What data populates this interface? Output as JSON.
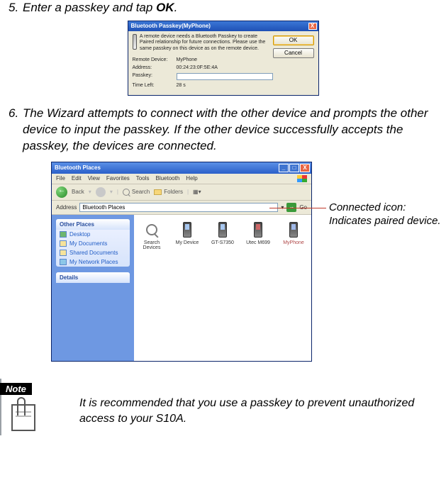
{
  "step5": {
    "num": "5.",
    "text_a": "Enter a passkey and tap ",
    "text_b": "OK",
    "text_c": "."
  },
  "passkey_dialog": {
    "title": "Bluetooth Passkey(MyPhone)",
    "message": "A remote device needs a Bluetooth Passkey to create Paired relationship for future connections. Please use the same passkey on this device as on the remote device.",
    "fields": {
      "remote_label": "Remote Device:",
      "remote_value": "MyPhone",
      "address_label": "Address:",
      "address_value": "00:24:23:0F:5E:4A",
      "passkey_label": "Passkey:",
      "passkey_value": "",
      "timeleft_label": "Time Left:",
      "timeleft_value": "28 s"
    },
    "buttons": {
      "ok": "OK",
      "cancel": "Cancel"
    },
    "close": "X"
  },
  "step6": {
    "num": "6.",
    "text": "The Wizard attempts to connect with the other device and prompts the other device to input the passkey. If the other device successfully accepts the passkey, the devices are connected."
  },
  "explorer": {
    "title": "Bluetooth Places",
    "menu": [
      "File",
      "Edit",
      "View",
      "Favorites",
      "Tools",
      "Bluetooth",
      "Help"
    ],
    "toolbar": {
      "back": "Back",
      "search": "Search",
      "folders": "Folders"
    },
    "address_label": "Address",
    "address_value": "Bluetooth Places",
    "go": "Go",
    "side_other_places": {
      "title": "Other Places",
      "items": [
        "Desktop",
        "My Documents",
        "Shared Documents",
        "My Network Places"
      ]
    },
    "side_details": {
      "title": "Details"
    },
    "devices": [
      {
        "label": "Search Devices"
      },
      {
        "label": "My Device"
      },
      {
        "label": "GT-S7350"
      },
      {
        "label": "Utec M699"
      },
      {
        "label": "MyPhone"
      }
    ],
    "win_min": "_",
    "win_max": "□",
    "win_close": "X"
  },
  "callout": "Connected icon: Indicates paired device.",
  "note": {
    "badge": "Note",
    "text": "It is recommended that you use a passkey to prevent unauthorized access to your S10A."
  }
}
